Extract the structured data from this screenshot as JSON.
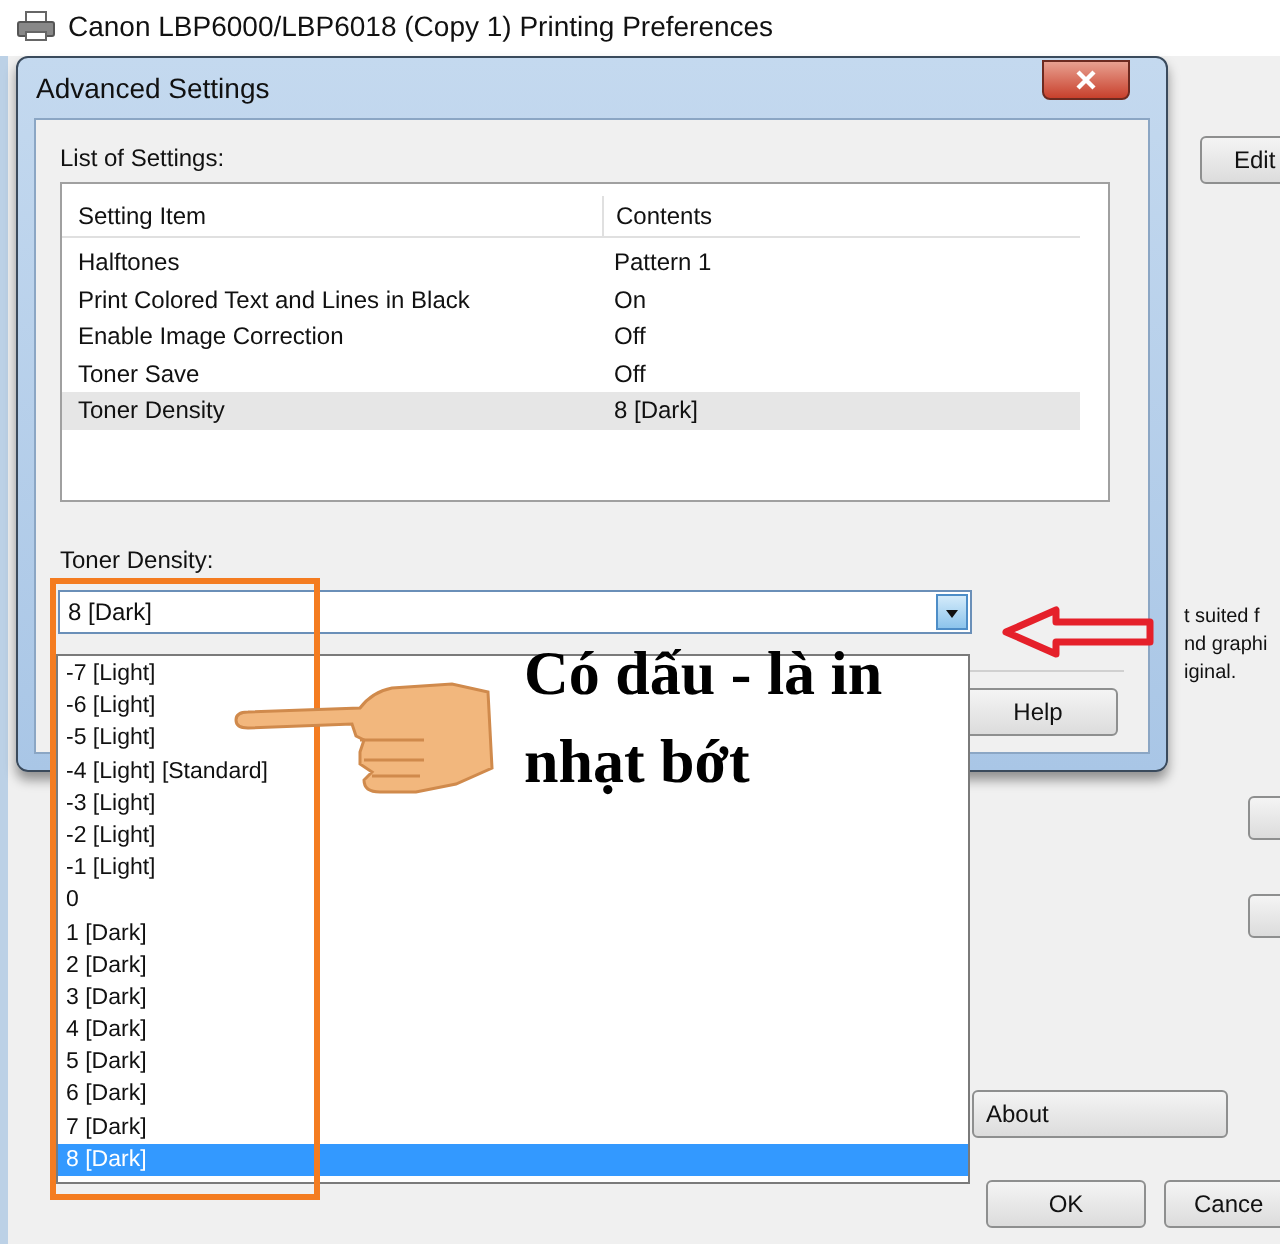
{
  "main_window": {
    "title": "Canon LBP6000/LBP6018 (Copy 1) Printing Preferences",
    "edit_button": "Edit",
    "partial_text": [
      "t suited f",
      "nd graphi",
      "iginal."
    ],
    "about_button": "About",
    "ok_button": "OK",
    "cancel_button": "Cance"
  },
  "dialog": {
    "title": "Advanced Settings",
    "list_label": "List of Settings:",
    "columns": [
      "Setting Item",
      "Contents"
    ],
    "rows": [
      {
        "item": "Halftones",
        "contents": "Pattern 1",
        "selected": false
      },
      {
        "item": "Print Colored Text and Lines in Black",
        "contents": "On",
        "selected": false
      },
      {
        "item": "Enable Image Correction",
        "contents": "Off",
        "selected": false
      },
      {
        "item": "Toner Save",
        "contents": "Off",
        "selected": false
      },
      {
        "item": "Toner Density",
        "contents": "8 [Dark]",
        "selected": true
      }
    ],
    "field_label": "Toner Density:",
    "dropdown": {
      "value": "8 [Dark]",
      "expanded": true,
      "options": [
        {
          "label": "-7 [Light]",
          "selected": false
        },
        {
          "label": "-6 [Light]",
          "selected": false
        },
        {
          "label": "-5 [Light]",
          "selected": false
        },
        {
          "label": "-4 [Light] [Standard]",
          "selected": false
        },
        {
          "label": "-3 [Light]",
          "selected": false
        },
        {
          "label": "-2 [Light]",
          "selected": false
        },
        {
          "label": "-1 [Light]",
          "selected": false
        },
        {
          "label": "0",
          "selected": false
        },
        {
          "label": "1 [Dark]",
          "selected": false
        },
        {
          "label": "2 [Dark]",
          "selected": false
        },
        {
          "label": "3 [Dark]",
          "selected": false
        },
        {
          "label": "4 [Dark]",
          "selected": false
        },
        {
          "label": "5 [Dark]",
          "selected": false
        },
        {
          "label": "6 [Dark]",
          "selected": false
        },
        {
          "label": "7 [Dark]",
          "selected": false
        },
        {
          "label": "8 [Dark]",
          "selected": true
        }
      ]
    },
    "help_button": "Help"
  },
  "annotation": {
    "caption": "Có dấu - là in nhạt bớt"
  }
}
